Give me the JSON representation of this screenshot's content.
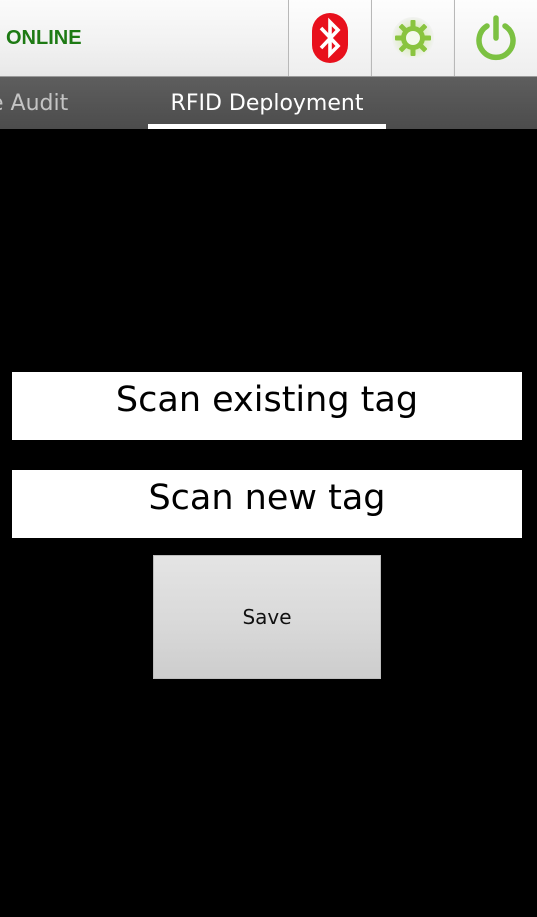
{
  "header": {
    "status_label": "ONLINE",
    "status_color": "#1e7a14",
    "actions": [
      {
        "icon": "bluetooth-icon",
        "color": "#e8101c"
      },
      {
        "icon": "gear-icon",
        "color": "#8ac43f"
      },
      {
        "icon": "power-icon",
        "color": "#7cc142"
      }
    ]
  },
  "tabs": [
    {
      "label": "e Audit",
      "selected": false
    },
    {
      "label": "RFID Deployment",
      "selected": true
    }
  ],
  "main": {
    "existing_tag_label": "Scan existing tag",
    "new_tag_label": "Scan new tag",
    "save_label": "Save"
  }
}
